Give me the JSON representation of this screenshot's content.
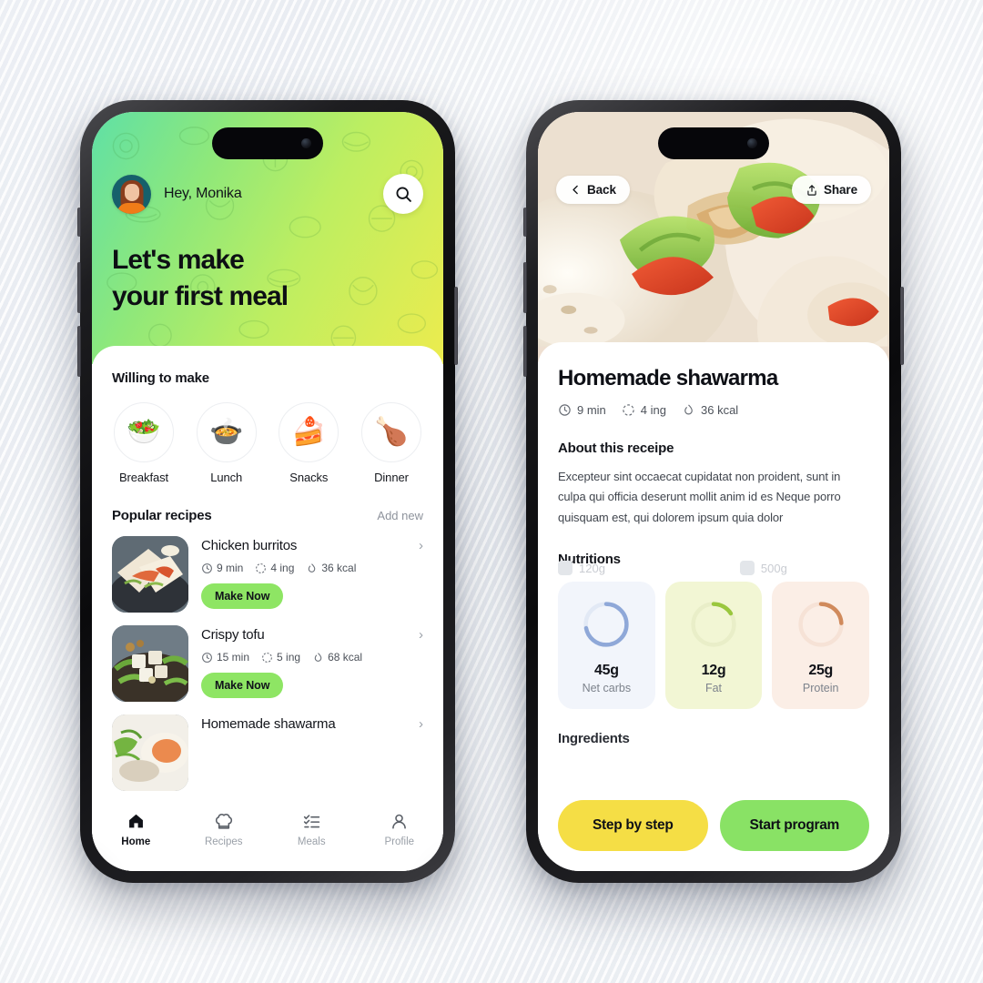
{
  "theme": {
    "hero_gradient_start": "#5fe0a6",
    "hero_gradient_mid": "#bdee61",
    "hero_gradient_end": "#ecec4e",
    "accent_green": "#8ee564",
    "accent_yellow": "#f5de45",
    "background": "#e9ecf1"
  },
  "home": {
    "greeting": "Hey, Monika",
    "search_icon": "search-icon",
    "avatar": "user-avatar",
    "hero_title": "Let's make\nyour first meal",
    "willing_section_title": "Willing to make",
    "categories": [
      {
        "label": "Breakfast",
        "emoji": "🥗",
        "icon": "breakfast-bowl-icon"
      },
      {
        "label": "Lunch",
        "emoji": "🍲",
        "icon": "lunch-plate-icon"
      },
      {
        "label": "Snacks",
        "emoji": "🍰",
        "icon": "snacks-cake-icon"
      },
      {
        "label": "Dinner",
        "emoji": "🍗",
        "icon": "dinner-roast-icon"
      }
    ],
    "popular_section_title": "Popular recipes",
    "add_new_label": "Add new",
    "recipes": [
      {
        "name": "Chicken burritos",
        "time": "9 min",
        "ingredients": "4 ing",
        "calories": "36 kcal",
        "action_label": "Make Now",
        "chevron": "chevron-right-icon"
      },
      {
        "name": "Crispy tofu",
        "time": "15 min",
        "ingredients": "5 ing",
        "calories": "68 kcal",
        "action_label": "Make Now",
        "chevron": "chevron-right-icon"
      },
      {
        "name": "Homemade shawarma",
        "time": "",
        "ingredients": "",
        "calories": "",
        "action_label": "",
        "chevron": "chevron-right-icon"
      }
    ],
    "tabs": [
      {
        "label": "Home",
        "icon": "home-icon",
        "active": true
      },
      {
        "label": "Recipes",
        "icon": "chef-hat-icon",
        "active": false
      },
      {
        "label": "Meals",
        "icon": "checklist-icon",
        "active": false
      },
      {
        "label": "Profile",
        "icon": "person-icon",
        "active": false
      }
    ]
  },
  "detail": {
    "back_label": "Back",
    "back_icon": "chevron-left-icon",
    "share_label": "Share",
    "share_icon": "share-upload-icon",
    "title": "Homemade shawarma",
    "time": "9 min",
    "ingredients": "4 ing",
    "calories": "36 kcal",
    "about_heading": "About this receipe",
    "about_text": "Excepteur sint occaecat cupidatat non proident, sunt in culpa qui officia deserunt mollit anim id es Neque porro quisquam est, qui dolorem ipsum quia dolor",
    "nutritions_heading": "Nutritions",
    "nutritions": [
      {
        "value": "45g",
        "label": "Net carbs",
        "percent": 72,
        "ring_color": "#8fa8d8",
        "track_color": "#e2e9f5",
        "bg": "#f2f5fb"
      },
      {
        "value": "12g",
        "label": "Fat",
        "percent": 16,
        "ring_color": "#9ac73e",
        "track_color": "#e9eec8",
        "bg": "#f2f6d4"
      },
      {
        "value": "25g",
        "label": "Protein",
        "percent": 24,
        "ring_color": "#d08a5c",
        "track_color": "#f6e2d6",
        "bg": "#fbeee6"
      }
    ],
    "ingredients_heading": "Ingredients",
    "ingredient_items": [
      {
        "amount": "120g"
      },
      {
        "amount": "500g"
      }
    ],
    "cta_secondary": "Step by step",
    "cta_primary": "Start program"
  }
}
